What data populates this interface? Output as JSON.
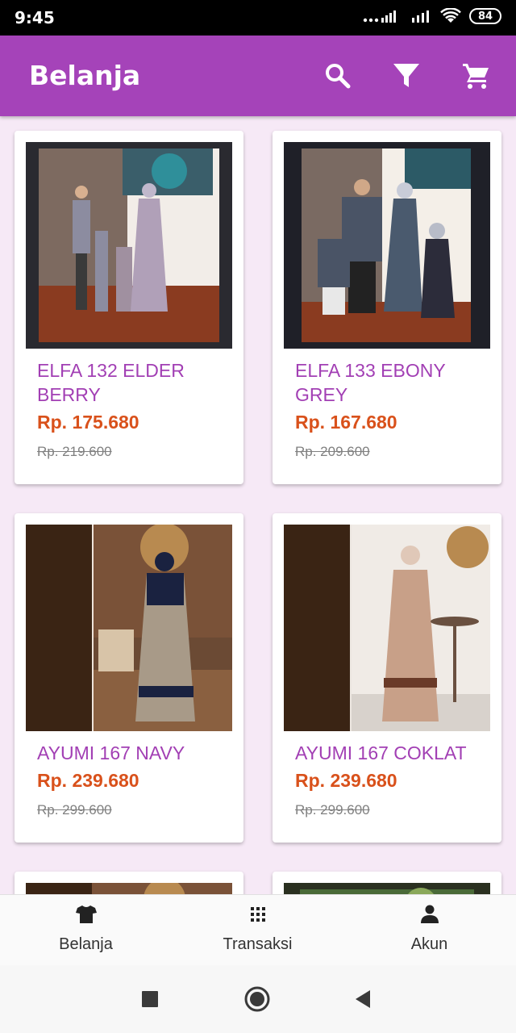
{
  "status_bar": {
    "time": "9:45",
    "battery": "84"
  },
  "app_bar": {
    "title": "Belanja",
    "actions": [
      "search-icon",
      "filter-icon",
      "cart-icon"
    ]
  },
  "products": [
    {
      "name": "ELFA 132 ELDER BERRY",
      "price": "Rp. 175.680",
      "old_price": "Rp. 219.600"
    },
    {
      "name": "ELFA 133 EBONY GREY",
      "price": "Rp. 167.680",
      "old_price": "Rp. 209.600"
    },
    {
      "name": "AYUMI 167 NAVY",
      "price": "Rp. 239.680",
      "old_price": "Rp. 299.600"
    },
    {
      "name": "AYUMI 167 COKLAT",
      "price": "Rp. 239.680",
      "old_price": "Rp. 299.600"
    }
  ],
  "bottom_nav": [
    {
      "label": "Belanja",
      "icon": "tshirt-icon"
    },
    {
      "label": "Transaksi",
      "icon": "grid-icon"
    },
    {
      "label": "Akun",
      "icon": "person-icon"
    }
  ],
  "colors": {
    "primary": "#a543b9",
    "price": "#d9511b",
    "background": "#f6e9f6"
  }
}
